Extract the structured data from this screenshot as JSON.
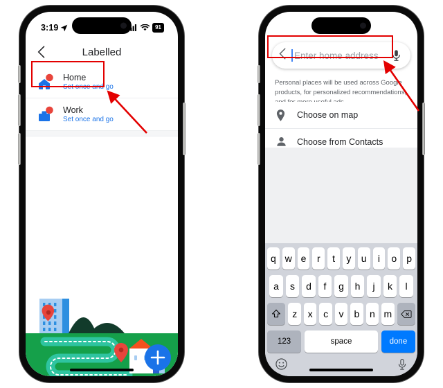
{
  "phone_left": {
    "status_bar": {
      "time": "3:19",
      "location_icon": "location-arrow-icon",
      "cellular_icon": "cellular-bars-icon",
      "wifi_icon": "wifi-icon",
      "battery_level": "91"
    },
    "nav": {
      "back_icon": "chevron-left-icon",
      "title": "Labelled"
    },
    "list": [
      {
        "icon": "home-pin-icon",
        "title": "Home",
        "subtitle": "Set once and go"
      },
      {
        "icon": "work-pin-icon",
        "title": "Work",
        "subtitle": "Set once and go"
      }
    ],
    "illustration": {
      "name": "map-places-illustration",
      "fab_label": "+",
      "colors": {
        "grass": "#15a04a",
        "road": "#2ec4a0",
        "building": "#a7cdf2",
        "building_side": "#2d8fe0",
        "hill": "#123b2b",
        "pin": "#e8453c",
        "house_roof": "#f4511e",
        "fab": "#1a73e8"
      }
    }
  },
  "phone_right": {
    "search": {
      "back_icon": "chevron-left-icon",
      "placeholder": "Enter home address",
      "value": "",
      "mic_icon": "microphone-icon"
    },
    "disclaimer": "Personal places will be used across Google products, for personalized recommendations, and for more useful ads.",
    "options": [
      {
        "icon": "map-pin-icon",
        "label": "Choose on map"
      },
      {
        "icon": "person-icon",
        "label": "Choose from Contacts"
      }
    ],
    "keyboard": {
      "row1": [
        "q",
        "w",
        "e",
        "r",
        "t",
        "y",
        "u",
        "i",
        "o",
        "p"
      ],
      "row2": [
        "a",
        "s",
        "d",
        "f",
        "g",
        "h",
        "j",
        "k",
        "l"
      ],
      "row3": [
        "z",
        "x",
        "c",
        "v",
        "b",
        "n",
        "m"
      ],
      "shift_icon": "shift-up-icon",
      "backspace_icon": "backspace-icon",
      "numbers_label": "123",
      "space_label": "space",
      "done_label": "done",
      "emoji_icon": "emoji-smiley-icon",
      "dictation_icon": "microphone-icon"
    }
  },
  "annotations": {
    "highlight_color": "#e30000",
    "box_left_target": "home-list-row",
    "box_right_target": "search-input-field",
    "arrow_left": "arrow-pointing-to-home-row",
    "arrow_right": "arrow-pointing-to-search-field"
  }
}
